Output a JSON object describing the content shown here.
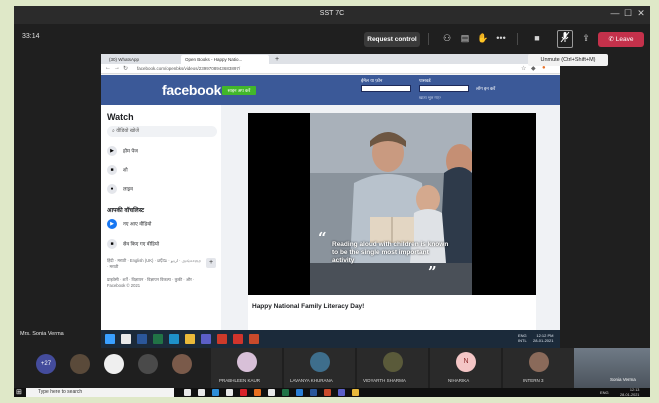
{
  "window": {
    "title": "SST 7C",
    "controls": [
      "—",
      "☐",
      "✕"
    ]
  },
  "meeting": {
    "timer": "33:14",
    "request_control": "Request control",
    "leave": "Leave",
    "tooltip": "Unmute (Ctrl+Shift+M)",
    "leave_color": "#c4314b"
  },
  "browser": {
    "tabs": [
      "(30) WhatsApp",
      "Open Books - Happy Natio..."
    ],
    "new_tab": "+",
    "url": "facebook.com/openbks/videos/2399708943683897/"
  },
  "facebook": {
    "logo": "facebook",
    "signup": "साइन अप करें",
    "email_label": "ईमेल या फ़ोन",
    "password_label": "पासवर्ड",
    "login": "लॉग इन करें",
    "forgot": "खाता भूल गए?",
    "brand_color": "#3b5998",
    "sidebar": {
      "title": "Watch",
      "search": "वीडियो खोजें",
      "items": [
        {
          "label": "होम पेज",
          "icon": "home-icon",
          "glyph": "▶"
        },
        {
          "label": "शो",
          "icon": "shows-icon",
          "glyph": "■"
        },
        {
          "label": "लाइव",
          "icon": "live-icon",
          "glyph": "●"
        }
      ],
      "section_title": "आपकी वॉचलिस्ट",
      "watchlist": [
        {
          "label": "नए आए वीडियो",
          "icon": "new-videos-icon",
          "glyph": "▶"
        },
        {
          "label": "सेव किए गए वीडियो",
          "icon": "saved-videos-icon",
          "glyph": "■"
        }
      ],
      "languages": "हिंदी · मराठी · English (UK) · ଓଡ଼ିଆ · اردو · அங்காரூர · मराठी",
      "plus": "+",
      "footer": "प्राइवेसी · शर्तें · विज्ञापन · विज्ञापन विकल्प · कुकी · और · Facebook © 2021"
    },
    "video": {
      "caption": "Reading aloud with children is known to be the single most important activity",
      "quote_open": "“",
      "quote_close": "”"
    },
    "post_title": "Happy National Family Literacy Day!"
  },
  "shared_taskbar": {
    "lang_line1": "ENG",
    "lang_line2": "INTL",
    "time": "12:12 PM",
    "date": "28-01-2021",
    "icons": [
      {
        "name": "windows-icon",
        "color": "#3aa0ff"
      },
      {
        "name": "store-icon",
        "color": "#e9e9e9"
      },
      {
        "name": "word-icon",
        "color": "#2b579a"
      },
      {
        "name": "excel-icon",
        "color": "#217346"
      },
      {
        "name": "edge-icon",
        "color": "#1e90c8"
      },
      {
        "name": "chrome-icon",
        "color": "#e8b93a"
      },
      {
        "name": "teams-icon",
        "color": "#5b5fc7"
      },
      {
        "name": "files-icon",
        "color": "#cc3a2a"
      },
      {
        "name": "acrobat-icon",
        "color": "#d0342c"
      },
      {
        "name": "powerpoint-icon",
        "color": "#c94a2b"
      }
    ]
  },
  "presenter": "Mrs. Sonia Verma",
  "participants": {
    "overflow": "+27",
    "overflow_color": "#444c9c",
    "bubbles": [
      {
        "initials": "",
        "color": "#5a4a3a"
      },
      {
        "initials": "",
        "color": "#efefef"
      },
      {
        "initials": "",
        "color": "#4a4a4a"
      },
      {
        "initials": "",
        "color": "#7a5a4a"
      }
    ],
    "tiles": [
      {
        "name": "PRABHLEEN KAUR",
        "initials": "",
        "color": "#d8c0d8"
      },
      {
        "name": "LAVANYA KHURANA",
        "initials": "",
        "color": "#3e6e8c"
      },
      {
        "name": "VIDYARTH SHARMA",
        "initials": "",
        "color": "#5a5a3a"
      },
      {
        "name": "NIHARIKA",
        "initials": "N",
        "color": "#f4c6c6"
      },
      {
        "name": "INTERN 3",
        "initials": "",
        "color": "#8a6a5a"
      }
    ],
    "self_view_name": "Sonia Verma"
  },
  "host_taskbar": {
    "search_placeholder": "Type here to search",
    "lang": "ENG",
    "time": "12:13",
    "date": "28-01-2021",
    "icons": [
      {
        "name": "task-view-icon",
        "color": "#e8e8e8"
      },
      {
        "name": "store-icon",
        "color": "#e8e8e8"
      },
      {
        "name": "edge-icon",
        "color": "#2c8ed8"
      },
      {
        "name": "mail-icon",
        "color": "#e8e8e8"
      },
      {
        "name": "opera-icon",
        "color": "#d8232a"
      },
      {
        "name": "firefox-icon",
        "color": "#e86f1f"
      },
      {
        "name": "photos-icon",
        "color": "#e8e8e8"
      },
      {
        "name": "excel-icon",
        "color": "#217346"
      },
      {
        "name": "ie-icon",
        "color": "#2b7fd6"
      },
      {
        "name": "word-icon",
        "color": "#2b579a"
      },
      {
        "name": "powerpoint-icon",
        "color": "#c94a2b"
      },
      {
        "name": "teams-icon",
        "color": "#5b5fc7"
      },
      {
        "name": "chrome-icon",
        "color": "#e8b93a"
      }
    ]
  }
}
